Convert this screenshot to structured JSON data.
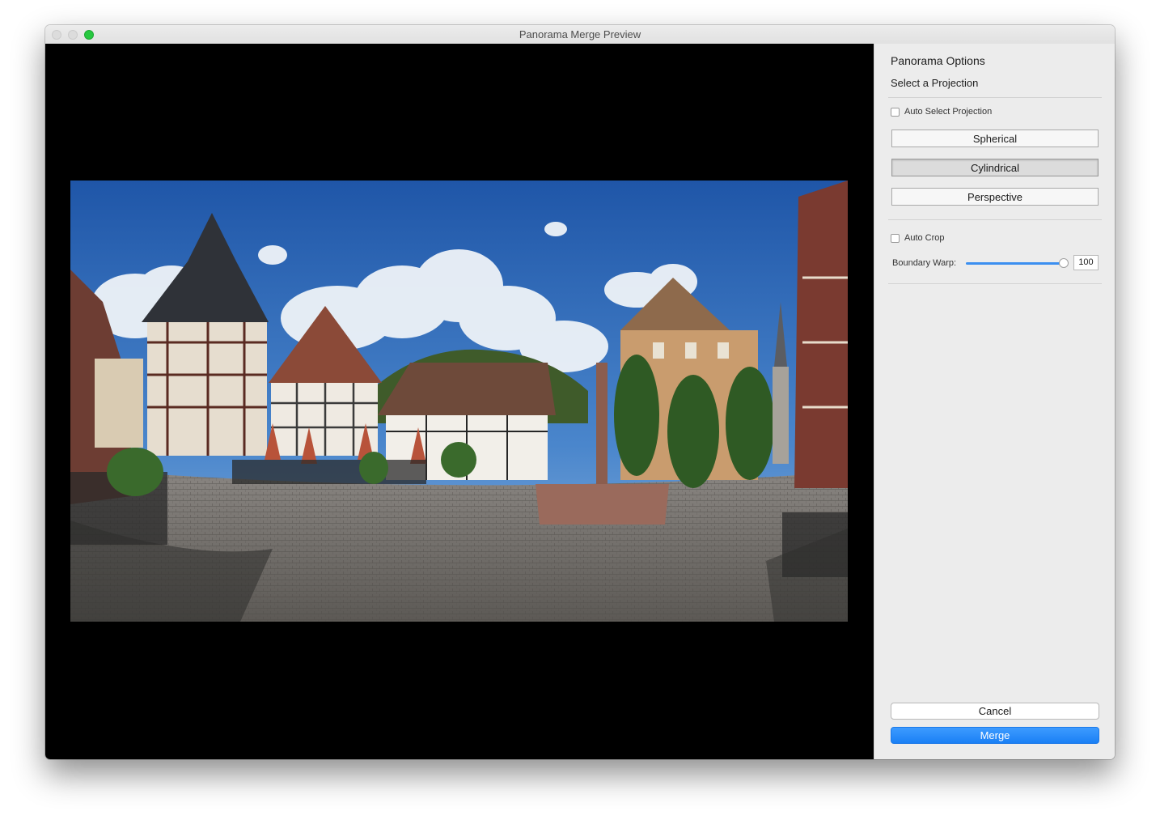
{
  "window": {
    "title": "Panorama Merge Preview"
  },
  "colors": {
    "accent": "#1a80f5",
    "zoom_button": "#27c840",
    "preview_background": "#000000"
  },
  "sidebar": {
    "section_title": "Panorama Options",
    "projection_heading": "Select a Projection",
    "auto_select_projection": {
      "label": "Auto Select Projection",
      "checked": false
    },
    "projections": [
      {
        "label": "Spherical",
        "selected": false
      },
      {
        "label": "Cylindrical",
        "selected": true
      },
      {
        "label": "Perspective",
        "selected": false
      }
    ],
    "auto_crop": {
      "label": "Auto Crop",
      "checked": false
    },
    "boundary_warp": {
      "label": "Boundary Warp:",
      "value": "100"
    },
    "cancel_label": "Cancel",
    "merge_label": "Merge"
  }
}
